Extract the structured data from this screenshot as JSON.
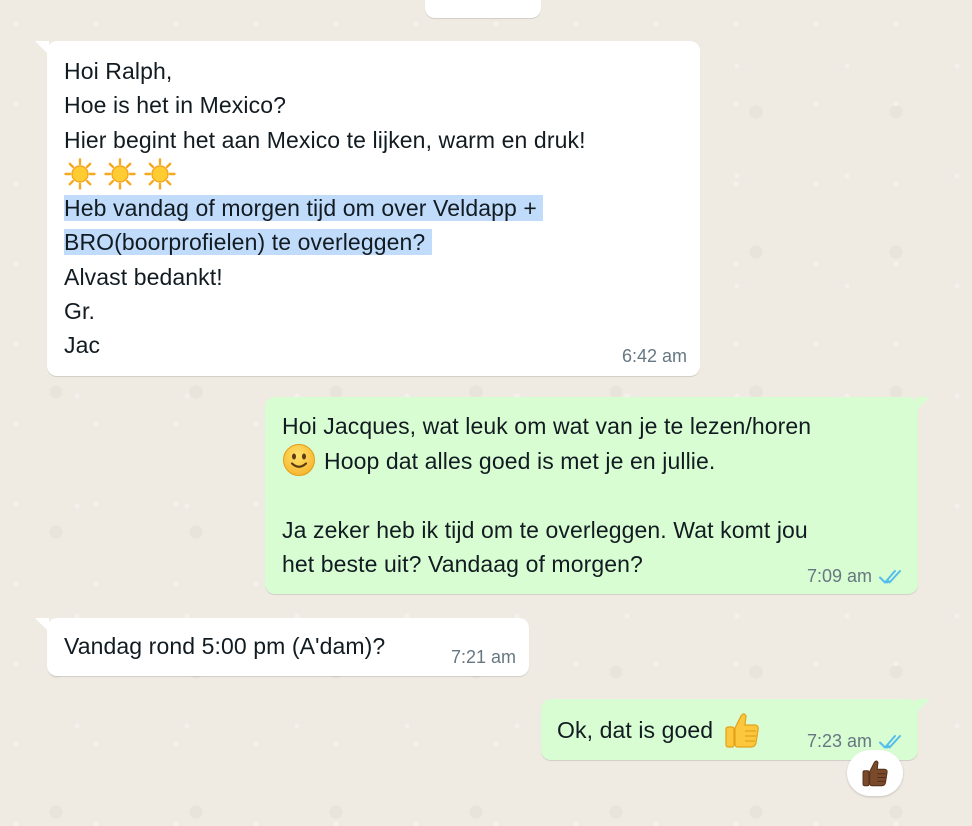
{
  "messages": [
    {
      "direction": "incoming",
      "lines": [
        "Hoi Ralph,",
        "Hoe is het in Mexico?",
        "Hier begint het aan Mexico te lijken, warm en druk!"
      ],
      "emoji_line": [
        "sun-icon",
        "sun-icon",
        "sun-icon"
      ],
      "highlighted_lines": [
        "Heb vandag of morgen tijd om over Veldapp + ",
        "BRO(boorprofielen) te overleggen? "
      ],
      "closing_lines": [
        "Alvast bedankt!",
        "Gr.",
        "Jac"
      ],
      "time": "6:42 am"
    },
    {
      "direction": "outgoing",
      "line1": "Hoi Jacques, wat leuk om wat van je te lezen/horen",
      "emoji": "smile-icon",
      "line2": "Hoop dat alles goed is met je en jullie.",
      "line3": "Ja zeker heb ik tijd om te overleggen. Wat komt jou",
      "line4": "het beste uit? Vandaag of morgen?",
      "time": "7:09 am",
      "status": "read"
    },
    {
      "direction": "incoming",
      "text": "Vandag rond 5:00 pm (A'dam)?",
      "time": "7:21 am"
    },
    {
      "direction": "outgoing",
      "text": "Ok, dat is goed",
      "emoji": "thumbs-up-icon",
      "time": "7:23 am",
      "status": "read",
      "reaction": "thumbs-up-dark-icon"
    }
  ],
  "colors": {
    "background": "#efeae2",
    "incoming_bubble": "#ffffff",
    "outgoing_bubble": "#d9fdd3",
    "highlight": "#c1dcfb",
    "meta_text": "#667781",
    "read_ticks": "#53bdeb"
  }
}
